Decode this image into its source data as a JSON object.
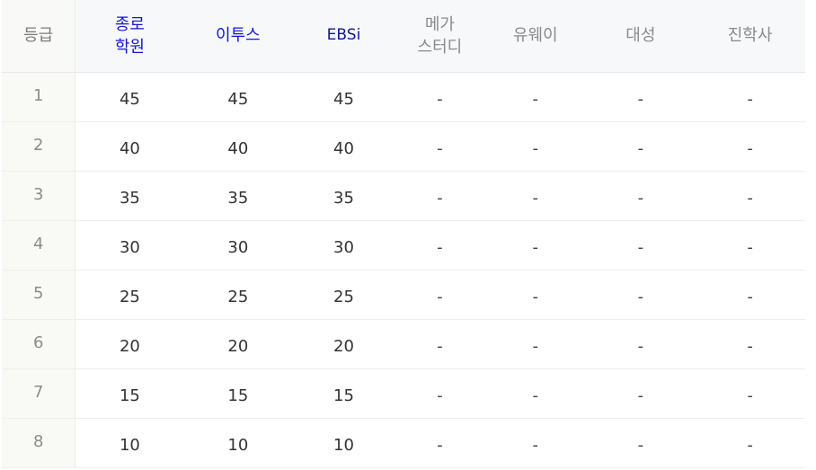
{
  "headers": [
    "등급",
    "종로\n학원",
    "이투스",
    "EBSi",
    "메가\n스터디",
    "유웨이",
    "대성",
    "진학사"
  ],
  "rows": [
    [
      "1",
      "45",
      "45",
      "45",
      "-",
      "-",
      "-",
      "-"
    ],
    [
      "2",
      "40",
      "40",
      "40",
      "-",
      "-",
      "-",
      "-"
    ],
    [
      "3",
      "35",
      "35",
      "35",
      "-",
      "-",
      "-",
      "-"
    ],
    [
      "4",
      "30",
      "30",
      "30",
      "-",
      "-",
      "-",
      "-"
    ],
    [
      "5",
      "25",
      "25",
      "25",
      "-",
      "-",
      "-",
      "-"
    ],
    [
      "6",
      "20",
      "20",
      "20",
      "-",
      "-",
      "-",
      "-"
    ],
    [
      "7",
      "15",
      "15",
      "15",
      "-",
      "-",
      "-",
      "-"
    ],
    [
      "8",
      "10",
      "10",
      "10",
      "-",
      "-",
      "-",
      "-"
    ]
  ],
  "colors": {
    "highlight_header": "#1515d6",
    "ebsi_header": "#14149a",
    "header_bg": "#f7f8fa",
    "grade_bg": "#f9f9f6"
  }
}
